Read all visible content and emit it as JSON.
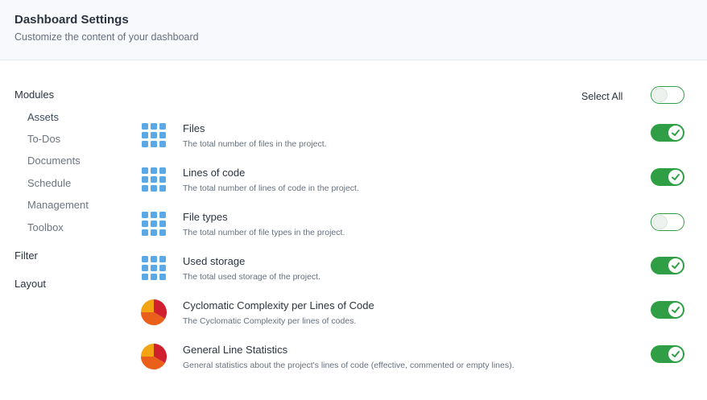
{
  "header": {
    "title": "Dashboard Settings",
    "subtitle": "Customize the content of your dashboard"
  },
  "sidebar": {
    "sections": [
      {
        "label": "Modules",
        "items": [
          "Assets",
          "To-Dos",
          "Documents",
          "Schedule",
          "Management",
          "Toolbox"
        ],
        "active_item": "Assets"
      },
      {
        "label": "Filter"
      },
      {
        "label": "Layout"
      }
    ]
  },
  "select_all": {
    "label": "Select All",
    "enabled": false
  },
  "modules": [
    {
      "title": "Files",
      "description": "The total number of files in the project.",
      "icon": "grid-icon",
      "enabled": true
    },
    {
      "title": "Lines of code",
      "description": "The total number of lines of code in the project.",
      "icon": "grid-icon",
      "enabled": true
    },
    {
      "title": "File types",
      "description": "The total number of file types in the project.",
      "icon": "grid-icon",
      "enabled": false
    },
    {
      "title": "Used storage",
      "description": "The total used storage of the project.",
      "icon": "grid-icon",
      "enabled": true
    },
    {
      "title": "Cyclomatic Complexity per Lines of Code",
      "description": "The Cyclomatic Complexity per lines of codes.",
      "icon": "pie-chart-icon",
      "enabled": true
    },
    {
      "title": "General Line Statistics",
      "description": "General statistics about the project's lines of code (effective, commented or empty lines).",
      "icon": "pie-chart-icon",
      "enabled": true
    }
  ],
  "colors": {
    "toggle_on": "#2f9e44",
    "grid_icon": "#5aa9e6",
    "pie_yellow": "#f2a413",
    "pie_red": "#d0202e",
    "pie_orange": "#ea5f1a"
  }
}
